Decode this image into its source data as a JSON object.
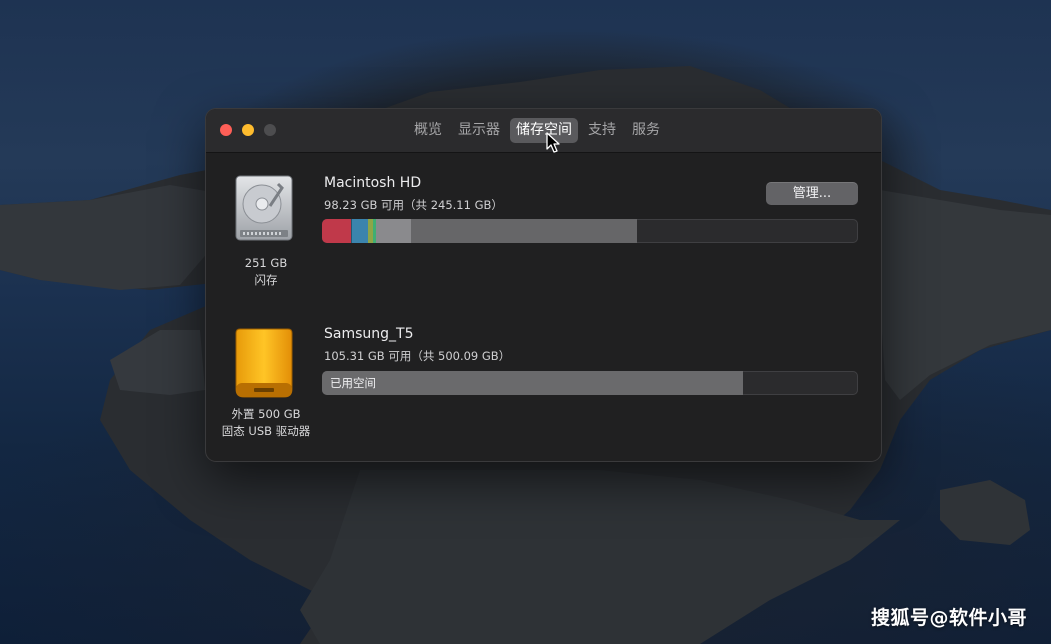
{
  "tabs": [
    {
      "label": "概览",
      "active": false
    },
    {
      "label": "显示器",
      "active": false
    },
    {
      "label": "储存空间",
      "active": true
    },
    {
      "label": "支持",
      "active": false
    },
    {
      "label": "服务",
      "active": false
    }
  ],
  "disks": [
    {
      "name": "Macintosh HD",
      "capacity_text": "98.23 GB 可用（共 245.11 GB）",
      "size_caption": "251 GB",
      "type_caption": "闪存",
      "icon": "hard-drive-icon",
      "usage_segments": [
        {
          "color": "#c0394a",
          "fraction": 0.055
        },
        {
          "color": "#3b84ad",
          "fraction": 0.03
        },
        {
          "color": "#8ea548",
          "fraction": 0.01
        },
        {
          "color": "#3fae73",
          "fraction": 0.006
        },
        {
          "color": "#8a8a8d",
          "fraction": 0.066
        },
        {
          "color": "#666668",
          "fraction": 0.422
        }
      ]
    },
    {
      "name": "Samsung_T5",
      "capacity_text": "105.31 GB 可用（共 500.09 GB）",
      "size_caption": "外置 500 GB",
      "type_caption": "固态 USB 驱动器",
      "icon": "external-ssd-icon",
      "bar_label": "已用空间",
      "usage_segments": [
        {
          "color": "#6a6a6c",
          "fraction": 0.785
        }
      ]
    }
  ],
  "manage_button": "管理...",
  "watermark": "搜狐号@软件小哥"
}
